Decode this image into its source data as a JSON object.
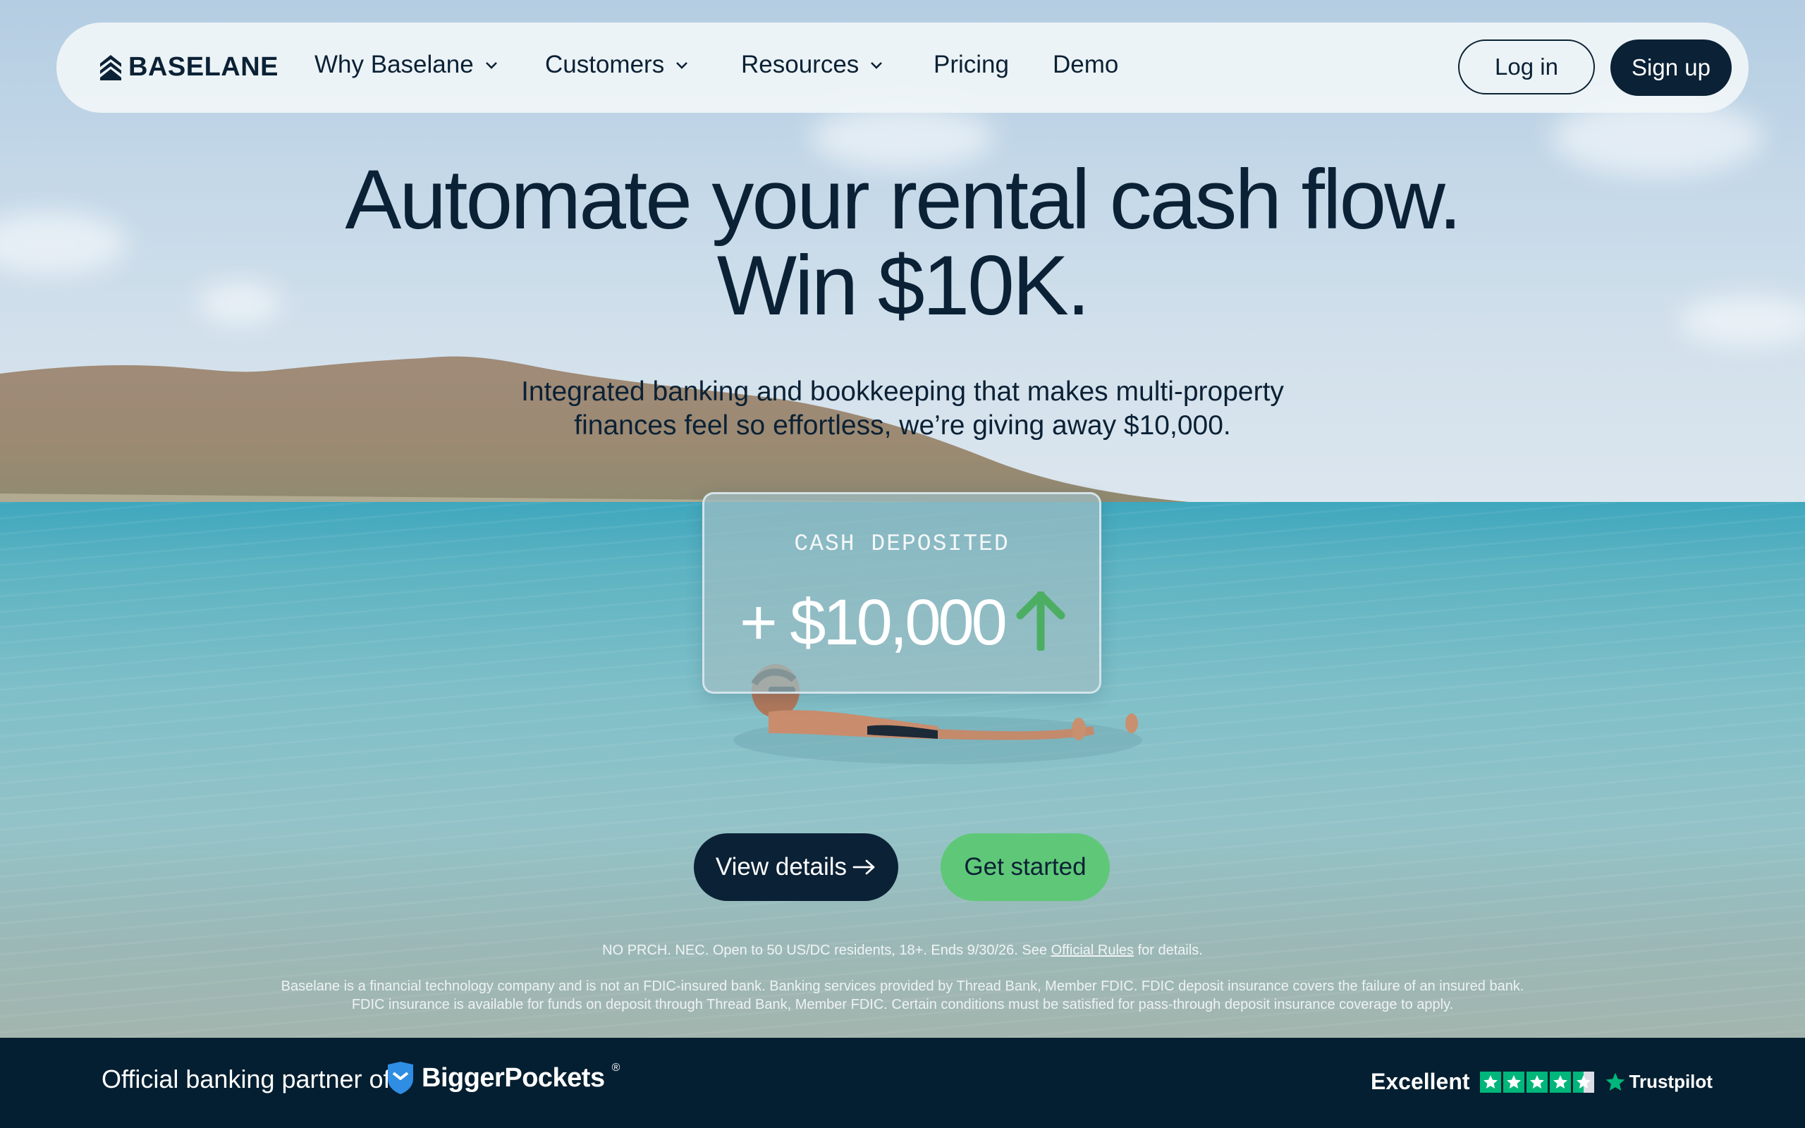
{
  "nav": {
    "logo": "BASELANE",
    "items": [
      {
        "label": "Why Baselane",
        "has_dropdown": true
      },
      {
        "label": "Customers",
        "has_dropdown": true
      },
      {
        "label": "Resources",
        "has_dropdown": true
      },
      {
        "label": "Pricing",
        "has_dropdown": false
      },
      {
        "label": "Demo",
        "has_dropdown": false
      }
    ],
    "login_label": "Log in",
    "signup_label": "Sign up"
  },
  "hero": {
    "headline_line1": "Automate your rental cash flow.",
    "headline_line2": "Win $10K.",
    "subhead_line1": "Integrated banking and bookkeeping that makes multi-property",
    "subhead_line2": "finances feel so effortless, we’re giving away $10,000."
  },
  "card": {
    "label": "CASH DEPOSITED",
    "amount": "+ $10,000",
    "arrow_icon": "arrow-up-icon"
  },
  "cta": {
    "view_details": "View details",
    "get_started": "Get started"
  },
  "legal": {
    "sweepstakes_prefix": "NO PRCH. NEC. Open to 50 US/DC residents, 18+. Ends 9/30/26. See",
    "official_rules": "Official Rules",
    "sweepstakes_suffix": "for details.",
    "disclaimer": "Baselane is a financial technology company and is not an FDIC-insured bank. Banking services provided by Thread Bank, Member FDIC. FDIC deposit insurance covers the failure of an insured bank. FDIC insurance is available for funds on deposit through Thread Bank, Member FDIC. Certain conditions must be satisfied for pass-through deposit insurance coverage to apply."
  },
  "footer": {
    "partner_text": "Official banking partner of",
    "partner_brand": "BiggerPockets",
    "registered_mark": "®",
    "rating_text": "Excellent",
    "rating_stars": 4.5,
    "rating_brand": "Trustpilot"
  },
  "colors": {
    "navy": "#0b2135",
    "green": "#5fc878",
    "footer_bg": "#041f31",
    "trustpilot_green": "#00b67a"
  }
}
